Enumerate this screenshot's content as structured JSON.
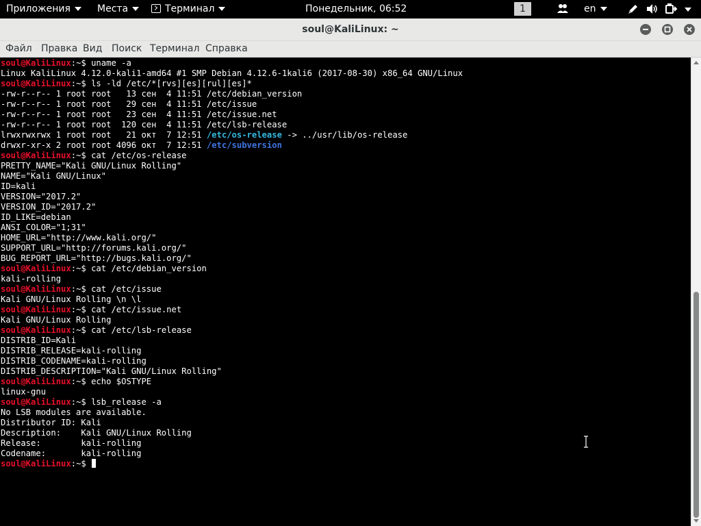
{
  "panel": {
    "apps_label": "Приложения",
    "places_label": "Места",
    "terminal_app_label": "Терминал",
    "clock": "Понедельник, 06:52",
    "workspace": "1",
    "keyboard_layout": "en",
    "icons": [
      "people-icon",
      "pen-icon",
      "volume-icon",
      "power-icon",
      "chevron-down-icon"
    ]
  },
  "window": {
    "title": "soul@KaliLinux: ~",
    "controls": [
      "minimize-icon",
      "maximize-icon",
      "close-icon"
    ]
  },
  "menubar": {
    "items": [
      "Файл",
      "Правка",
      "Вид",
      "Поиск",
      "Терминал",
      "Справка"
    ]
  },
  "prompt": {
    "user_host": "soul@KaliLinux",
    "suffix": ":~$ "
  },
  "terminal": {
    "lines": [
      {
        "type": "cmd",
        "text": "uname -a"
      },
      {
        "type": "out",
        "text": "Linux KaliLinux 4.12.0-kali1-amd64 #1 SMP Debian 4.12.6-1kali6 (2017-08-30) x86_64 GNU/Linux"
      },
      {
        "type": "cmd",
        "text": "ls -ld /etc/*[rvs][es][rul][es]*"
      },
      {
        "type": "out",
        "text": "-rw-r--r-- 1 root root   13 сен  4 11:51 /etc/debian_version"
      },
      {
        "type": "out",
        "text": "-rw-r--r-- 1 root root   29 сен  4 11:51 /etc/issue"
      },
      {
        "type": "out",
        "text": "-rw-r--r-- 1 root root   23 сен  4 11:51 /etc/issue.net"
      },
      {
        "type": "out",
        "text": "-rw-r--r-- 1 root root  120 сен  4 11:51 /etc/lsb-release"
      },
      {
        "type": "link",
        "pre": "lrwxrwxrwx 1 root root   21 окт  7 12:51 ",
        "name": "/etc/os-release",
        "post": " -> ../usr/lib/os-release"
      },
      {
        "type": "dir",
        "pre": "drwxr-xr-x 2 root root 4096 окт  7 12:51 ",
        "name": "/etc/subversion"
      },
      {
        "type": "cmd",
        "text": "cat /etc/os-release"
      },
      {
        "type": "out",
        "text": "PRETTY_NAME=\"Kali GNU/Linux Rolling\""
      },
      {
        "type": "out",
        "text": "NAME=\"Kali GNU/Linux\""
      },
      {
        "type": "out",
        "text": "ID=kali"
      },
      {
        "type": "out",
        "text": "VERSION=\"2017.2\""
      },
      {
        "type": "out",
        "text": "VERSION_ID=\"2017.2\""
      },
      {
        "type": "out",
        "text": "ID_LIKE=debian"
      },
      {
        "type": "out",
        "text": "ANSI_COLOR=\"1;31\""
      },
      {
        "type": "out",
        "text": "HOME_URL=\"http://www.kali.org/\""
      },
      {
        "type": "out",
        "text": "SUPPORT_URL=\"http://forums.kali.org/\""
      },
      {
        "type": "out",
        "text": "BUG_REPORT_URL=\"http://bugs.kali.org/\""
      },
      {
        "type": "cmd",
        "text": "cat /etc/debian_version"
      },
      {
        "type": "out",
        "text": "kali-rolling"
      },
      {
        "type": "cmd",
        "text": "cat /etc/issue"
      },
      {
        "type": "out",
        "text": "Kali GNU/Linux Rolling \\n \\l"
      },
      {
        "type": "cmd",
        "text": "cat /etc/issue.net"
      },
      {
        "type": "out",
        "text": "Kali GNU/Linux Rolling"
      },
      {
        "type": "cmd",
        "text": "cat /etc/lsb-release"
      },
      {
        "type": "out",
        "text": "DISTRIB_ID=Kali"
      },
      {
        "type": "out",
        "text": "DISTRIB_RELEASE=kali-rolling"
      },
      {
        "type": "out",
        "text": "DISTRIB_CODENAME=kali-rolling"
      },
      {
        "type": "out",
        "text": "DISTRIB_DESCRIPTION=\"Kali GNU/Linux Rolling\""
      },
      {
        "type": "cmd",
        "text": "echo $OSTYPE"
      },
      {
        "type": "out",
        "text": "linux-gnu"
      },
      {
        "type": "cmd",
        "text": "lsb_release -a"
      },
      {
        "type": "out",
        "text": "No LSB modules are available."
      },
      {
        "type": "out",
        "text": "Distributor ID:\tKali"
      },
      {
        "type": "out",
        "text": "Description:\tKali GNU/Linux Rolling"
      },
      {
        "type": "out",
        "text": "Release:\tkali-rolling"
      },
      {
        "type": "out",
        "text": "Codename:\tkali-rolling"
      },
      {
        "type": "cmd",
        "text": "",
        "cursor": true
      }
    ]
  },
  "colors": {
    "prompt_user": "#e8102a",
    "symlink": "#35b6de",
    "directory": "#3f74e0",
    "terminal_bg": "#000000",
    "panel_bg": "#000000",
    "titlebar_bg": "#e8e8e7"
  }
}
